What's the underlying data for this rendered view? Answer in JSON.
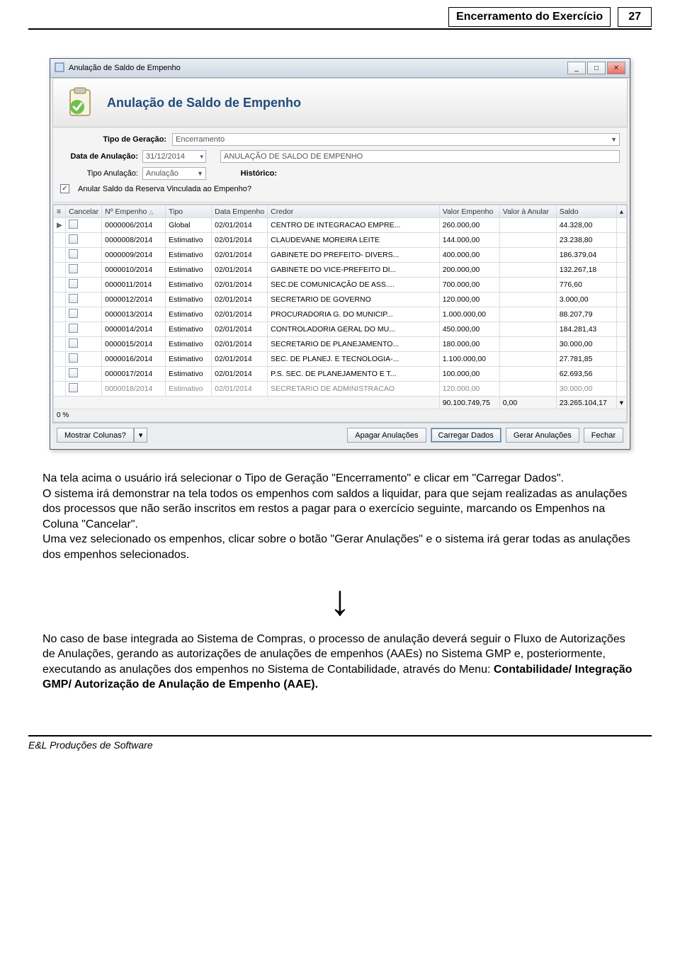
{
  "page_header": {
    "title": "Encerramento do Exercício",
    "page_number": "27"
  },
  "page_footer": "E&L Produções de Software",
  "window": {
    "title": "Anulação de Saldo de Empenho",
    "hero_title": "Anulação de Saldo de Empenho",
    "win_buttons": {
      "minimize": "_",
      "maximize": "□",
      "close": "✕"
    }
  },
  "form": {
    "tipo_geracao_label": "Tipo de Geração:",
    "tipo_geracao_value": "Encerramento",
    "data_anulacao_label": "Data de Anulação:",
    "data_anulacao_value": "31/12/2014",
    "tipo_anulacao_label": "Tipo Anulação:",
    "tipo_anulacao_value": "Anulação",
    "historico_label": "Histórico:",
    "historico_value": "ANULAÇÃO DE SALDO DE EMPENHO",
    "reserva_check_label": "Anular Saldo da Reserva Vinculada ao Empenho?",
    "reserva_checked": "✓"
  },
  "grid": {
    "headers": {
      "row_ind": "",
      "cancelar": "Cancelar",
      "num_empenho": "Nº Empenho",
      "tipo": "Tipo",
      "data_empenho": "Data Empenho",
      "credor": "Credor",
      "valor_empenho": "Valor Empenho",
      "valor_anular": "Valor à Anular",
      "saldo": "Saldo",
      "scroll": ""
    },
    "rows": [
      {
        "ind": "▶",
        "num": "0000006/2014",
        "tipo": "Global",
        "data": "02/01/2014",
        "credor": "CENTRO DE INTEGRACAO EMPRE...",
        "valor": "260.000,00",
        "anular": "",
        "saldo": "44.328,00"
      },
      {
        "ind": "",
        "num": "0000008/2014",
        "tipo": "Estimativo",
        "data": "02/01/2014",
        "credor": "CLAUDEVANE MOREIRA LEITE",
        "valor": "144.000,00",
        "anular": "",
        "saldo": "23.238,80"
      },
      {
        "ind": "",
        "num": "0000009/2014",
        "tipo": "Estimativo",
        "data": "02/01/2014",
        "credor": "GABINETE DO PREFEITO- DIVERS...",
        "valor": "400.000,00",
        "anular": "",
        "saldo": "186.379,04"
      },
      {
        "ind": "",
        "num": "0000010/2014",
        "tipo": "Estimativo",
        "data": "02/01/2014",
        "credor": "GABINETE DO VICE-PREFEITO DI...",
        "valor": "200.000,00",
        "anular": "",
        "saldo": "132.267,18"
      },
      {
        "ind": "",
        "num": "0000011/2014",
        "tipo": "Estimativo",
        "data": "02/01/2014",
        "credor": "SEC.DE COMUNICAÇÃO DE ASS....",
        "valor": "700.000,00",
        "anular": "",
        "saldo": "776,60"
      },
      {
        "ind": "",
        "num": "0000012/2014",
        "tipo": "Estimativo",
        "data": "02/01/2014",
        "credor": "SECRETARIO DE GOVERNO",
        "valor": "120.000,00",
        "anular": "",
        "saldo": "3.000,00"
      },
      {
        "ind": "",
        "num": "0000013/2014",
        "tipo": "Estimativo",
        "data": "02/01/2014",
        "credor": "PROCURADORIA G. DO MUNICIP...",
        "valor": "1.000.000,00",
        "anular": "",
        "saldo": "88.207,79"
      },
      {
        "ind": "",
        "num": "0000014/2014",
        "tipo": "Estimativo",
        "data": "02/01/2014",
        "credor": "CONTROLADORIA GERAL DO MU...",
        "valor": "450.000,00",
        "anular": "",
        "saldo": "184.281,43"
      },
      {
        "ind": "",
        "num": "0000015/2014",
        "tipo": "Estimativo",
        "data": "02/01/2014",
        "credor": "SECRETARIO DE PLANEJAMENTO...",
        "valor": "180.000,00",
        "anular": "",
        "saldo": "30.000,00"
      },
      {
        "ind": "",
        "num": "0000016/2014",
        "tipo": "Estimativo",
        "data": "02/01/2014",
        "credor": "SEC. DE PLANEJ. E TECNOLOGIA-...",
        "valor": "1.100.000,00",
        "anular": "",
        "saldo": "27.781,85"
      },
      {
        "ind": "",
        "num": "0000017/2014",
        "tipo": "Estimativo",
        "data": "02/01/2014",
        "credor": "P.S. SEC. DE PLANEJAMENTO E T...",
        "valor": "100.000,00",
        "anular": "",
        "saldo": "62.693,56"
      },
      {
        "ind": "",
        "num": "0000018/2014",
        "tipo": "Estimativo",
        "data": "02/01/2014",
        "credor": "SECRETARIO DE ADMINISTRACAO",
        "valor": "120.000,00",
        "anular": "",
        "saldo": "30.000,00"
      }
    ],
    "totals": {
      "valor": "90.100.749,75",
      "anular": "0,00",
      "saldo": "23.265.104,17"
    },
    "progress": "0 %"
  },
  "buttons": {
    "mostrar_colunas": "Mostrar Colunas?",
    "apagar": "Apagar Anulações",
    "carregar": "Carregar Dados",
    "gerar": "Gerar Anulações",
    "fechar": "Fechar"
  },
  "body_text_1": "Na tela acima o usuário irá selecionar o Tipo de Geração \"Encerramento\" e clicar em \"Carregar Dados\".\nO sistema irá demonstrar na tela todos os empenhos com saldos a liquidar, para que sejam realizadas as anulações dos processos que não serão inscritos em restos a pagar para o exercício seguinte, marcando os Empenhos na Coluna \"Cancelar\".\nUma vez selecionado os empenhos, clicar sobre o botão \"Gerar Anulações\" e o sistema irá gerar todas as anulações dos empenhos selecionados.",
  "arrow": "↓",
  "body_text_2_plain": "No caso de base integrada ao Sistema de Compras, o processo de anulação deverá seguir o Fluxo de Autorizações de Anulações, gerando as autorizações de anulações de empenhos (AAEs) no Sistema GMP e, posteriormente, executando as anulações dos empenhos no Sistema de Contabilidade, através do Menu: ",
  "body_text_2_bold": "Contabilidade/ Integração GMP/ Autorização de Anulação de Empenho (AAE)."
}
